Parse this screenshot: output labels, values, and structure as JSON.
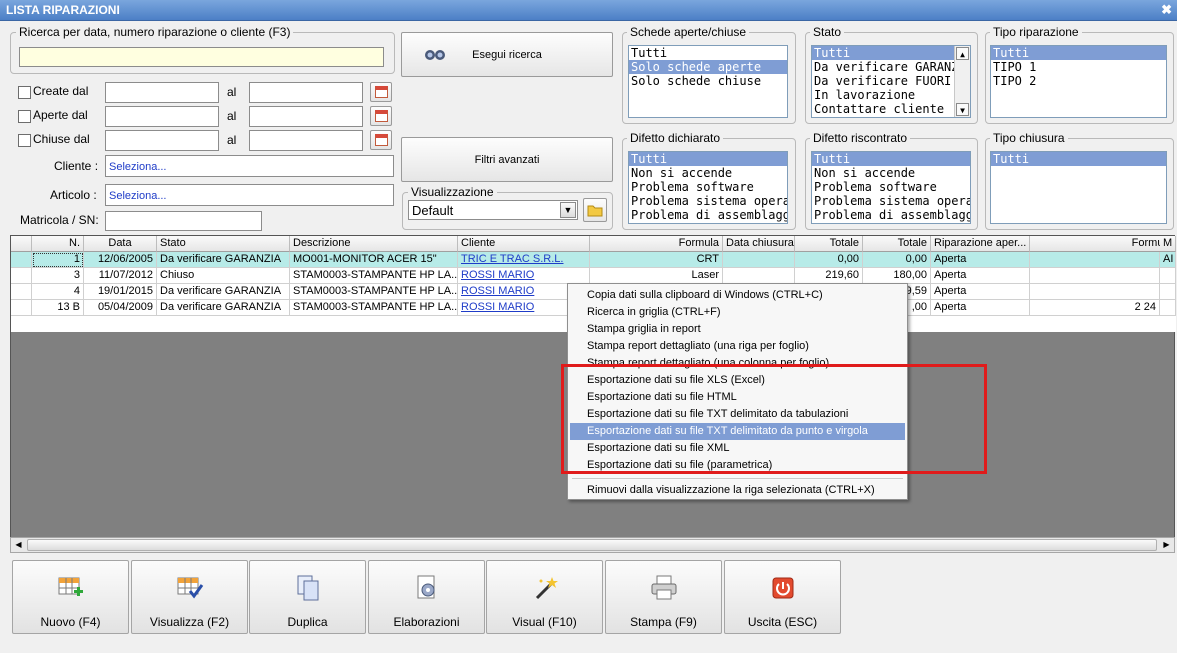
{
  "window": {
    "title": "LISTA RIPARAZIONI",
    "close_glyph": "✖"
  },
  "search": {
    "legend": "Ricerca per data, numero riparazione o cliente (F3)",
    "value": "",
    "execute_label": "Esegui ricerca",
    "advanced_label": "Filtri avanzati"
  },
  "dates": {
    "created_label": "Create dal",
    "opened_label": "Aperte dal",
    "closed_label": "Chiuse dal",
    "to_label": "al"
  },
  "fields": {
    "client_label": "Cliente :",
    "client_value": "Seleziona...",
    "article_label": "Articolo :",
    "article_value": "Seleziona...",
    "serial_label": "Matricola / SN:"
  },
  "view": {
    "legend": "Visualizzazione",
    "selected": "Default"
  },
  "panels": {
    "schede": {
      "legend": "Schede aperte/chiuse",
      "items": [
        "Tutti",
        "Solo schede aperte",
        "Solo schede chiuse"
      ],
      "selected": 1
    },
    "stato": {
      "legend": "Stato",
      "items": [
        "Tutti",
        "Da verificare GARANZI",
        "Da verificare FUORI GA",
        "In lavorazione",
        "Contattare cliente"
      ],
      "selected": 0
    },
    "tipo_riparazione": {
      "legend": "Tipo riparazione",
      "items": [
        "Tutti",
        "TIPO 1",
        "TIPO 2"
      ],
      "selected": 0
    },
    "difetto_dichiarato": {
      "legend": "Difetto dichiarato",
      "items": [
        "Tutti",
        "Non si accende",
        "Problema software",
        "Problema sistema operat",
        "Problema di assemblagg"
      ],
      "selected": 0
    },
    "difetto_riscontrato": {
      "legend": "Difetto riscontrato",
      "items": [
        "Tutti",
        "Non si accende",
        "Problema software",
        "Problema sistema operat",
        "Problema di assemblagg"
      ],
      "selected": 0
    },
    "tipo_chiusura": {
      "legend": "Tipo chiusura",
      "items": [
        "Tutti"
      ],
      "selected": 0
    }
  },
  "grid": {
    "columns": [
      "N.",
      "Data",
      "Stato",
      "Descrizione",
      "Cliente",
      "Formula",
      "Data chiusura",
      "Totale",
      "Totale",
      "Riparazione aper...",
      "Formula",
      "M"
    ],
    "rows": [
      [
        "1",
        "12/06/2005",
        "Da verificare GARANZIA",
        "MO001-MONITOR ACER 15\"",
        "TRIC E TRAC S.R.L.",
        "CRT",
        "",
        "0,00",
        "0,00",
        "Aperta",
        "",
        "AI"
      ],
      [
        "3",
        "11/07/2012",
        "Chiuso",
        "STAM0003-STAMPANTE HP LA...",
        "ROSSI MARIO",
        "Laser",
        "",
        "219,60",
        "180,00",
        "Aperta",
        "",
        ""
      ],
      [
        "4",
        "19/01/2015",
        "Da verificare GARANZIA",
        "STAM0003-STAMPANTE HP LA...",
        "ROSSI MARIO",
        "",
        "",
        "",
        "9,59",
        "Aperta",
        "",
        ""
      ],
      [
        "13 B",
        "05/04/2009",
        "Da verificare GARANZIA",
        "STAM0003-STAMPANTE HP LA...",
        "ROSSI MARIO",
        "",
        "",
        "",
        ",00",
        "Aperta",
        "2 24",
        ""
      ]
    ]
  },
  "context_menu": {
    "items": [
      "Copia dati sulla clipboard di Windows (CTRL+C)",
      "Ricerca in griglia (CTRL+F)",
      "Stampa griglia in report",
      "Stampa report dettagliato (una riga per foglio)",
      "Stampa report dettagliato (una colonna per foglio)",
      "Esportazione dati su file XLS (Excel)",
      "Esportazione dati su file HTML",
      "Esportazione dati su file TXT delimitato da tabulazioni",
      "Esportazione dati su file TXT delimitato da punto e virgola",
      "Esportazione dati su file XML",
      "Esportazione dati su file (parametrica)",
      "Rimuovi dalla visualizzazione la riga selezionata (CTRL+X)"
    ],
    "selected": 8
  },
  "toolbar": {
    "new": "Nuovo (F4)",
    "view": "Visualizza (F2)",
    "duplicate": "Duplica",
    "process": "Elaborazioni",
    "visual": "Visual (F10)",
    "print": "Stampa (F9)",
    "exit": "Uscita (ESC)"
  },
  "icons": {
    "binoculars": "binoculars-icon",
    "calendar": "calendar-icon",
    "folder": "folder-icon",
    "new": "grid-add-icon",
    "view": "grid-check-icon",
    "duplicate": "duplicate-icon",
    "process": "gear-document-icon",
    "visual": "magic-wand-icon",
    "print": "printer-icon",
    "exit": "power-icon"
  },
  "colors": {
    "selection": "#7f9dd4",
    "highlight_row": "#b7ebe8",
    "annotation": "#e01b1b",
    "title_bar": "#4c7fc6"
  }
}
